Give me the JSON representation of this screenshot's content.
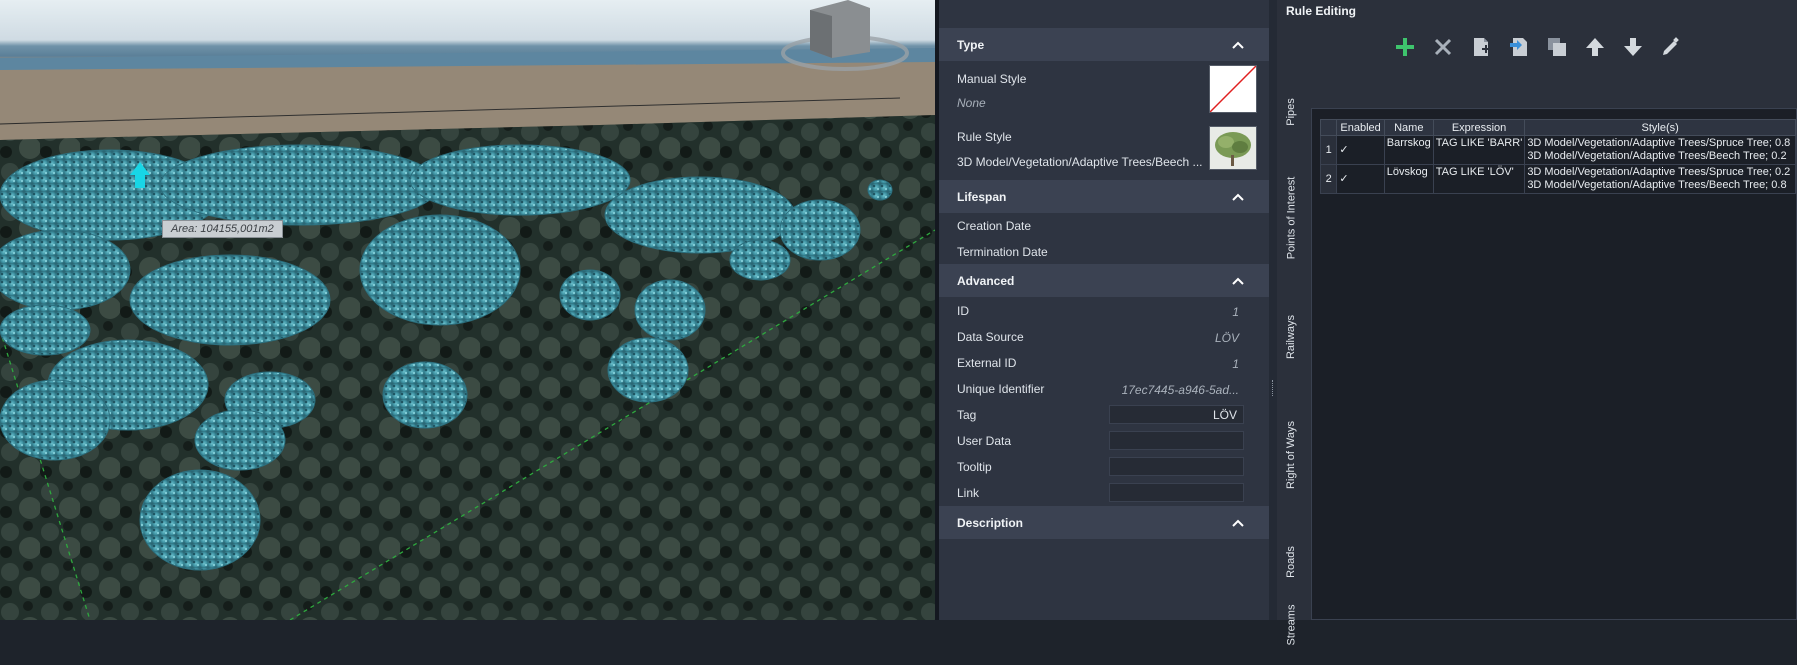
{
  "viewport": {
    "area_label": "Area: 104155,001m2"
  },
  "properties": {
    "sections": {
      "type": "Type",
      "lifespan": "Lifespan",
      "advanced": "Advanced",
      "description": "Description"
    },
    "manual_style": {
      "label": "Manual Style",
      "value": "None"
    },
    "rule_style": {
      "label": "Rule Style",
      "value": "3D Model/Vegetation/Adaptive Trees/Beech ..."
    },
    "creation_date": {
      "label": "Creation Date"
    },
    "termination_date": {
      "label": "Termination Date"
    },
    "id": {
      "label": "ID",
      "value": "1"
    },
    "data_source": {
      "label": "Data Source",
      "value": "LÖV"
    },
    "external_id": {
      "label": "External ID",
      "value": "1"
    },
    "unique_identifier": {
      "label": "Unique Identifier",
      "value": "17ec7445-a946-5ad..."
    },
    "tag": {
      "label": "Tag",
      "value": "LÖV"
    },
    "user_data": {
      "label": "User Data",
      "value": ""
    },
    "tooltip": {
      "label": "Tooltip",
      "value": ""
    },
    "link": {
      "label": "Link",
      "value": ""
    }
  },
  "rule_editing": {
    "title": "Rule Editing",
    "toolbar": [
      "add-icon",
      "delete-icon",
      "new-document-icon",
      "import-icon",
      "copy-icon",
      "move-up-icon",
      "move-down-icon",
      "edit-icon"
    ],
    "tabs": [
      "Pipes",
      "Points of Interest",
      "Railways",
      "Right of Ways",
      "Roads",
      "Streams"
    ],
    "columns": [
      "Enabled",
      "Name",
      "Expression",
      "Style(s)"
    ],
    "rows": [
      {
        "num": "1",
        "enabled": "✓",
        "name": "Barrskog",
        "expression": "TAG LIKE 'BARR'",
        "style_line1": "3D Model/Vegetation/Adaptive Trees/Spruce Tree; 0.8",
        "style_line2": "3D Model/Vegetation/Adaptive Trees/Beech Tree; 0.2"
      },
      {
        "num": "2",
        "enabled": "✓",
        "name": "Lövskog",
        "expression": "TAG LIKE 'LÖV'",
        "style_line1": "3D Model/Vegetation/Adaptive Trees/Spruce Tree; 0.2",
        "style_line2": "3D Model/Vegetation/Adaptive Trees/Beech Tree; 0.8"
      }
    ]
  },
  "colors": {
    "panel_bg": "#2e3441",
    "section_header": "#3b4252",
    "add_green": "#3ec46d",
    "tree_teal": "#4aa3b4"
  }
}
